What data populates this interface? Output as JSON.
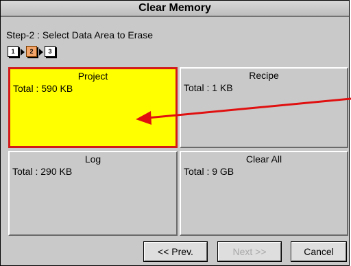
{
  "window": {
    "title": "Clear Memory"
  },
  "wizard": {
    "step_label": "Step-2 : Select Data Area to Erase",
    "steps": [
      "1",
      "2",
      "3"
    ],
    "current_step": 2
  },
  "areas": [
    {
      "title": "Project",
      "total": "Total : 590 KB",
      "selected": true
    },
    {
      "title": "Recipe",
      "total": "Total : 1 KB",
      "selected": false
    },
    {
      "title": "Log",
      "total": "Total : 290 KB",
      "selected": false
    },
    {
      "title": "Clear All",
      "total": "Total : 9 GB",
      "selected": false
    }
  ],
  "buttons": {
    "prev": "<< Prev.",
    "next": "Next >>",
    "cancel": "Cancel"
  },
  "colors": {
    "selected_fill": "#ffff00",
    "selected_border": "#d21a1a",
    "annotation_arrow": "#e01010"
  }
}
